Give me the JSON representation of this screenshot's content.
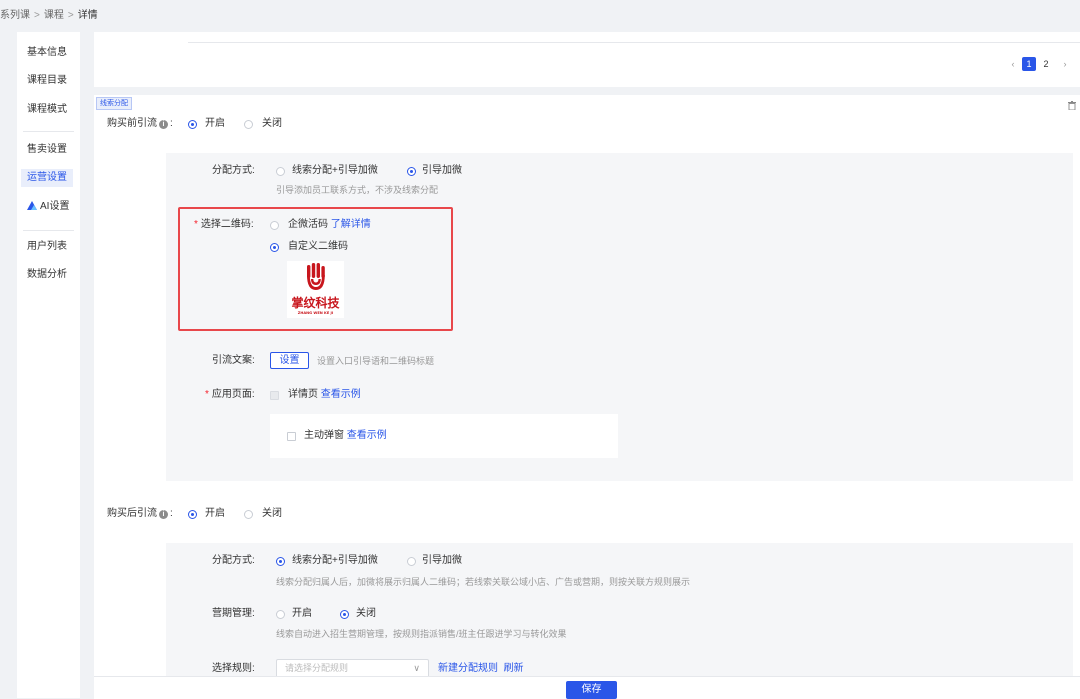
{
  "breadcrumb": {
    "item1": "系列课",
    "sep": ">",
    "item2": "课程",
    "current": "详情"
  },
  "sidebar": {
    "items": [
      {
        "label": "基本信息"
      },
      {
        "label": "课程目录"
      },
      {
        "label": "课程模式"
      },
      {
        "label": "售卖设置"
      },
      {
        "label": "运营设置"
      },
      {
        "label": "AI设置"
      },
      {
        "label": "用户列表"
      },
      {
        "label": "数据分析"
      }
    ]
  },
  "pagination": {
    "prev": "‹",
    "page1": "1",
    "page2": "2",
    "next": "›",
    "current": 1
  },
  "section": {
    "tag": "线索分配"
  },
  "pre": {
    "label": "购买前引流",
    "info": "i",
    "colon": ":",
    "opt_on": "开启",
    "opt_off": "关闭",
    "selected": "开启",
    "mode_label": "分配方式:",
    "mode_opt1": "线索分配+引导加微",
    "mode_opt2": "引导加微",
    "mode_selected": "引导加微",
    "mode_hint": "引导添加员工联系方式，不涉及线索分配",
    "qr_label": "选择二维码:",
    "qr_opt1": "企微活码",
    "qr_opt1_link": "了解详情",
    "qr_opt2": "自定义二维码",
    "qr_selected": "自定义二维码",
    "logo_cn": "掌纹科技",
    "logo_en": "ZHANG WEN KE JI",
    "copy_label": "引流文案:",
    "copy_button": "设置",
    "copy_hint": "设置入口引导语和二维码标题",
    "page_label": "应用页面:",
    "page_opt1": "详情页",
    "page_opt1_link": "查看示例",
    "popup_label": "主动弹窗",
    "popup_link": "查看示例"
  },
  "post": {
    "label": "购买后引流",
    "info": "i",
    "colon": ":",
    "opt_on": "开启",
    "opt_off": "关闭",
    "selected": "开启",
    "mode_label": "分配方式:",
    "mode_opt1": "线索分配+引导加微",
    "mode_opt2": "引导加微",
    "mode_selected": "线索分配+引导加微",
    "mode_hint": "线索分配归属人后，加微将展示归属人二维码；若线索关联公域小店、广告或营期，则按关联方规则展示",
    "period_label": "营期管理:",
    "period_on": "开启",
    "period_off": "关闭",
    "period_selected": "关闭",
    "period_hint": "线索自动进入招生营期管理，按规则指派销售/班主任跟进学习与转化效果",
    "rule_label": "选择规则:",
    "rule_placeholder": "请选择分配规则",
    "rule_new": "新建分配规则",
    "rule_refresh": "刷新"
  },
  "footer": {
    "save": "保存"
  },
  "colors": {
    "accent": "#2a56e8",
    "highlight_border": "#e8474b",
    "logo_red": "#c8161d"
  },
  "icons": [
    "info-icon",
    "trash-icon",
    "chevron-down-icon",
    "ai-logo-icon",
    "palm-logo-icon"
  ]
}
